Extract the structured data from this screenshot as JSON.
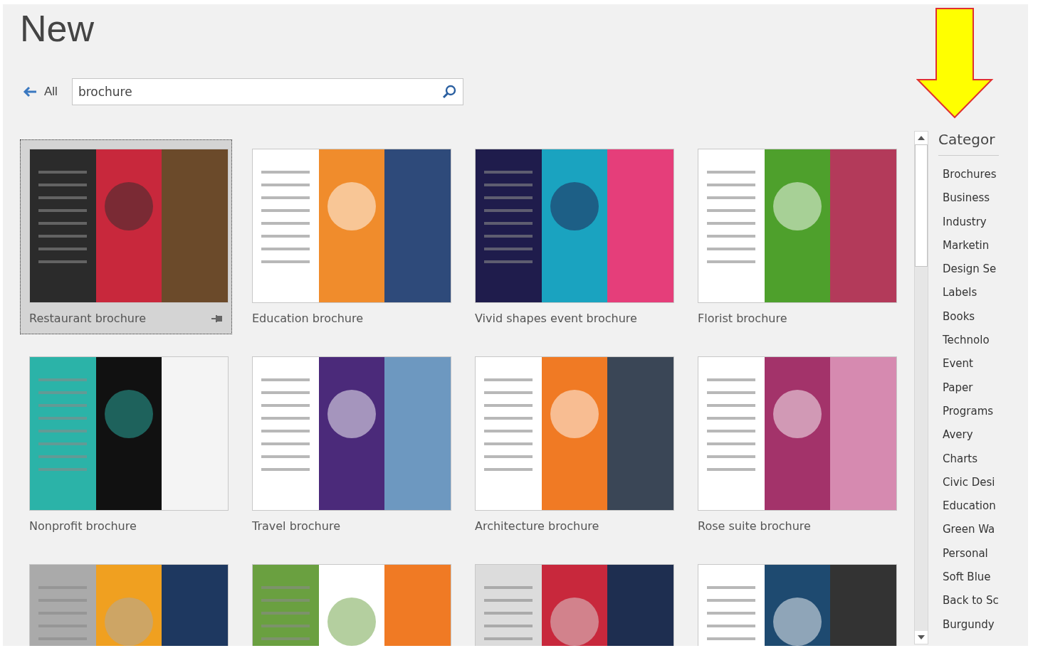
{
  "title": "New",
  "search": {
    "back_label": "All",
    "value": "brochure"
  },
  "templates": [
    {
      "title": "Restaurant brochure",
      "selected": true
    },
    {
      "title": "Education brochure",
      "selected": false
    },
    {
      "title": "Vivid shapes event brochure",
      "selected": false
    },
    {
      "title": "Florist brochure",
      "selected": false
    },
    {
      "title": "Nonprofit brochure",
      "selected": false
    },
    {
      "title": "Travel brochure",
      "selected": false
    },
    {
      "title": "Architecture brochure",
      "selected": false
    },
    {
      "title": "Rose suite brochure",
      "selected": false
    },
    {
      "selected": false
    },
    {
      "selected": false
    },
    {
      "selected": false
    },
    {
      "selected": false
    }
  ],
  "categories": {
    "heading": "Categor",
    "items": [
      "Brochures",
      "Business",
      "Industry",
      "Marketin",
      "Design Se",
      "Labels",
      "Books",
      "Technolo",
      "Event",
      "Paper",
      "Programs",
      "Avery",
      "Charts",
      "Civic Desi",
      "Education",
      "Green Wa",
      "Personal",
      "Soft Blue",
      "Back to Sc",
      "Burgundy"
    ]
  }
}
